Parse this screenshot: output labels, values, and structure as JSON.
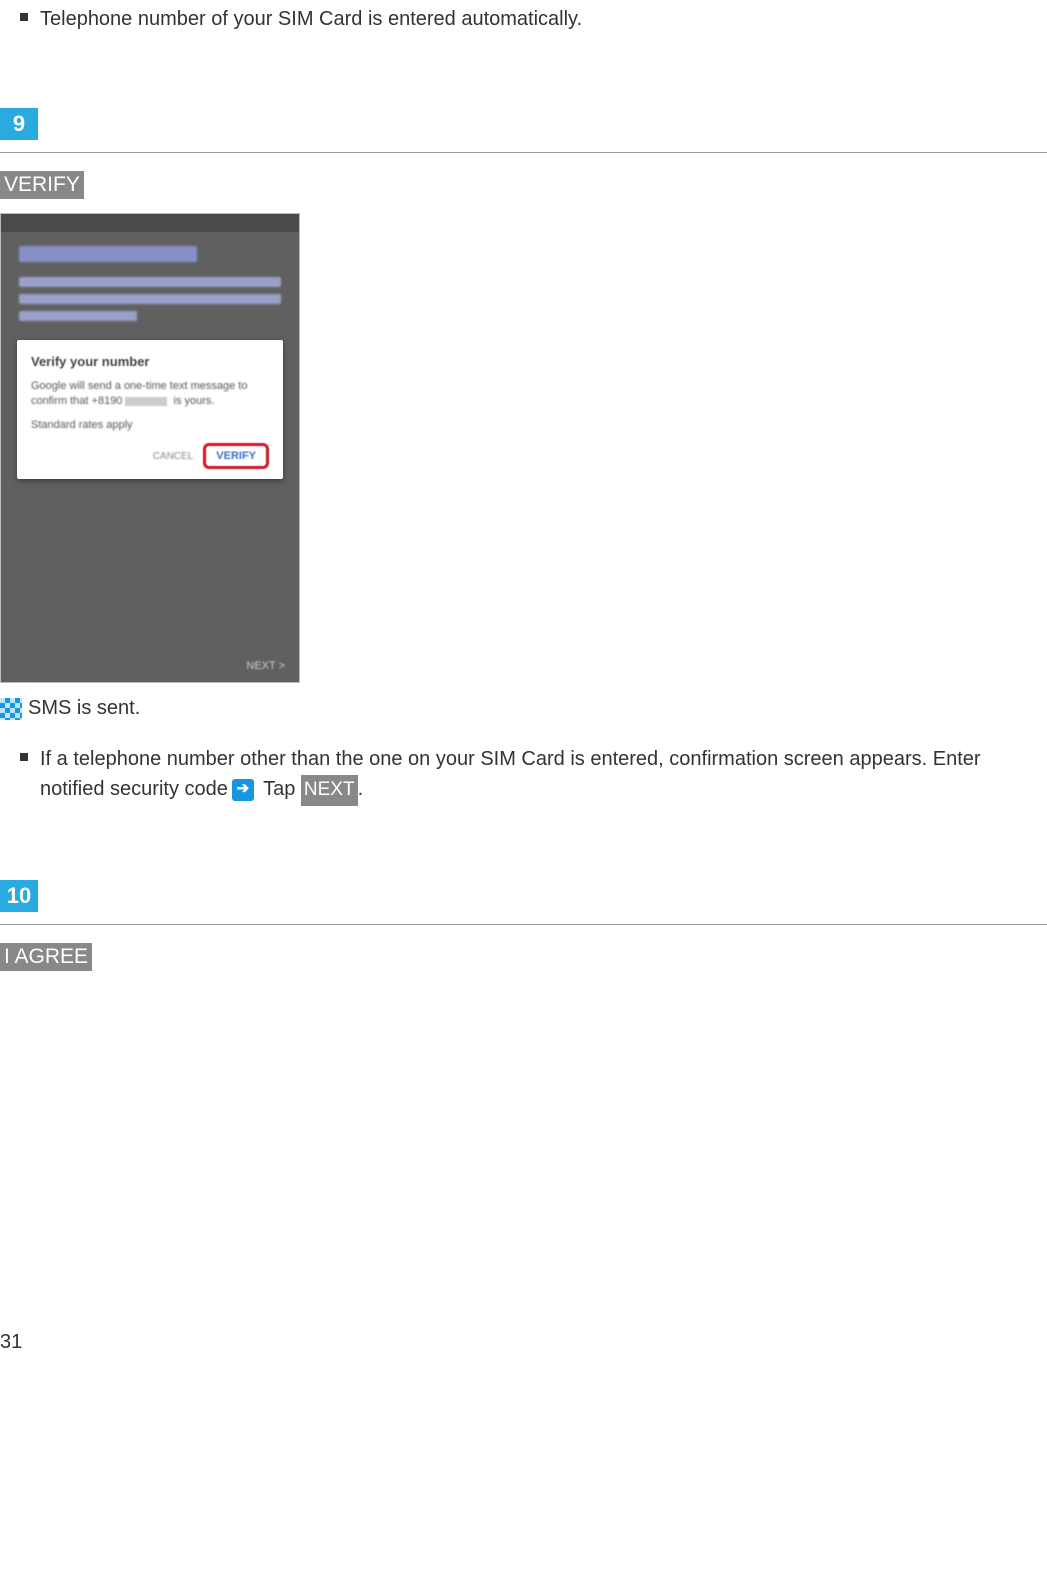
{
  "intro_bullet": "Telephone number of your SIM Card is entered automatically.",
  "step9": {
    "number": "9",
    "badge": "VERIFY",
    "dialog": {
      "title": "Verify your number",
      "body_prefix": "Google will send a one-time text message to confirm that",
      "phone_masked": "+8190",
      "body_suffix": "is yours.",
      "rates": "Standard rates apply",
      "cancel": "CANCEL",
      "verify": "VERIFY"
    },
    "phone_footer": "NEXT  >",
    "result": "SMS is sent.",
    "note_prefix": "If a telephone number other than the one on your SIM Card is entered, confirmation screen appears. Enter notified security code",
    "note_tap": "Tap",
    "note_next_badge": "NEXT",
    "note_period": "."
  },
  "step10": {
    "number": "10",
    "badge": "I AGREE"
  },
  "page_number": "31"
}
